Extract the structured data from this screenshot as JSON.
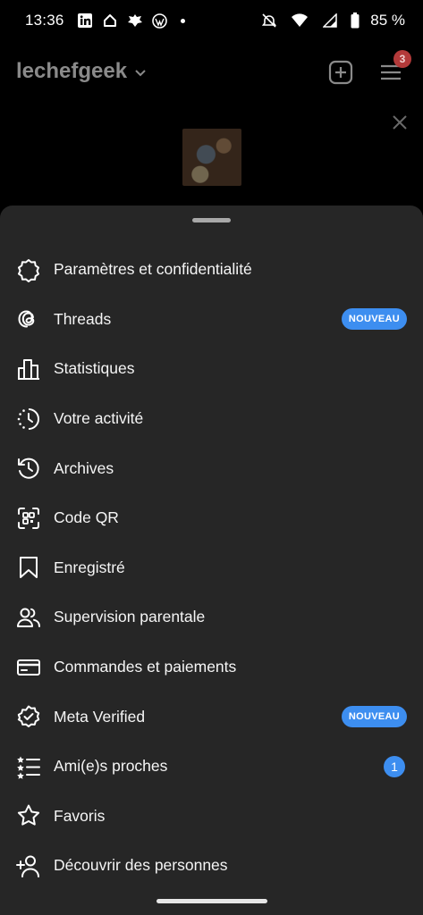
{
  "status_bar": {
    "time": "13:36",
    "battery": "85 %",
    "left_icons": [
      "linkedin-icon",
      "home-icon",
      "bug-icon",
      "wordpress-icon"
    ],
    "right_icons": [
      "mute-icon",
      "wifi-icon",
      "signal-icon",
      "battery-icon"
    ]
  },
  "background": {
    "username": "lechefgeek",
    "notification_count": "3"
  },
  "menu": {
    "items": [
      {
        "label": "Paramètres et confidentialité",
        "icon": "settings-icon"
      },
      {
        "label": "Threads",
        "icon": "threads-icon",
        "badge": "NOUVEAU"
      },
      {
        "label": "Statistiques",
        "icon": "bar-chart-icon"
      },
      {
        "label": "Votre activité",
        "icon": "activity-icon"
      },
      {
        "label": "Archives",
        "icon": "archive-icon"
      },
      {
        "label": "Code QR",
        "icon": "qr-code-icon"
      },
      {
        "label": "Enregistré",
        "icon": "bookmark-icon"
      },
      {
        "label": "Supervision parentale",
        "icon": "people-icon"
      },
      {
        "label": "Commandes et paiements",
        "icon": "card-icon"
      },
      {
        "label": "Meta Verified",
        "icon": "verified-icon",
        "badge": "NOUVEAU"
      },
      {
        "label": "Ami(e)s proches",
        "icon": "close-friends-icon",
        "count": "1"
      },
      {
        "label": "Favoris",
        "icon": "star-icon"
      },
      {
        "label": "Découvrir des personnes",
        "icon": "add-person-icon"
      }
    ]
  },
  "colors": {
    "sheet_bg": "#262626",
    "accent": "#3d8ef0",
    "notification_badge": "#b33a3a"
  }
}
